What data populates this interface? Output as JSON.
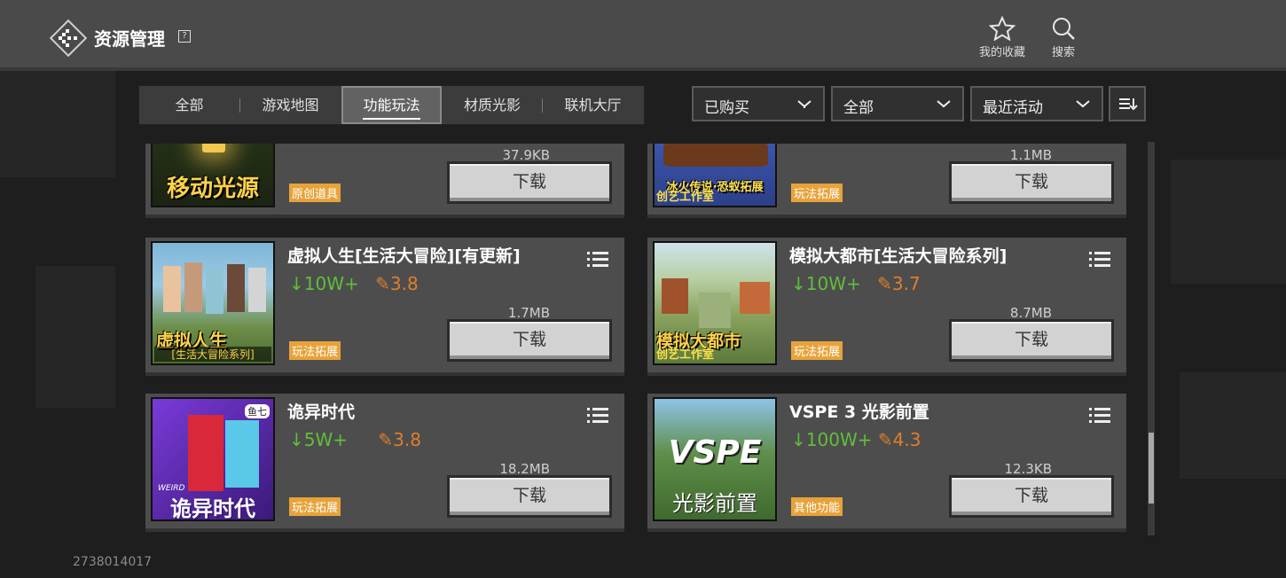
{
  "header": {
    "title": "资源管理",
    "help_icon": "help-icon",
    "favorites_label": "我的收藏",
    "search_label": "搜索"
  },
  "tabs": [
    {
      "label": "全部",
      "active": false
    },
    {
      "label": "游戏地图",
      "active": false
    },
    {
      "label": "功能玩法",
      "active": true
    },
    {
      "label": "材质光影",
      "active": false
    },
    {
      "label": "联机大厅",
      "active": false
    }
  ],
  "filters": {
    "purchase": "已购买",
    "category": "全部",
    "order": "最近活动",
    "sort_icon": "sort-icon"
  },
  "items": [
    {
      "title": "",
      "downloads": "",
      "rating": "",
      "size": "37.9KB",
      "tag": "原创道具",
      "download_label": "下载",
      "thumb_caption": "移动光源",
      "thumb_sub": ""
    },
    {
      "title": "",
      "downloads": "",
      "rating": "",
      "size": "1.1MB",
      "tag": "玩法拓展",
      "download_label": "下载",
      "thumb_caption": "冰火传说·恐蚁拓展",
      "thumb_sub": "创艺工作室"
    },
    {
      "title": "虚拟人生[生活大冒险][有更新]",
      "downloads": "10W+",
      "rating": "3.8",
      "size": "1.7MB",
      "tag": "玩法拓展",
      "download_label": "下载",
      "thumb_caption": "虚拟人生",
      "thumb_sub": "[生活大冒险系列]"
    },
    {
      "title": "模拟大都市[生活大冒险系列]",
      "downloads": "10W+",
      "rating": "3.7",
      "size": "8.7MB",
      "tag": "玩法拓展",
      "download_label": "下载",
      "thumb_caption": "模拟大都市",
      "thumb_sub": "创艺工作室"
    },
    {
      "title": "诡异时代",
      "downloads": "5W+",
      "rating": "3.8",
      "size": "18.2MB",
      "tag": "玩法拓展",
      "download_label": "下载",
      "thumb_caption": "诡异时代",
      "thumb_sub": "WEIRD",
      "thumb_badge": "鱼七"
    },
    {
      "title": "VSPE 3 光影前置",
      "downloads": "100W+",
      "rating": "4.3",
      "size": "12.3KB",
      "tag": "其他功能",
      "download_label": "下载",
      "thumb_caption": "VSPE",
      "thumb_sub": "光影前置"
    }
  ],
  "user_id": "2738014017",
  "colors": {
    "header_bg": "#4a4a4a",
    "card_bg": "#4d4d4d",
    "download_green": "#5fbf3a",
    "rating_orange": "#e07e2c",
    "tag_orange": "#e7a33a"
  }
}
